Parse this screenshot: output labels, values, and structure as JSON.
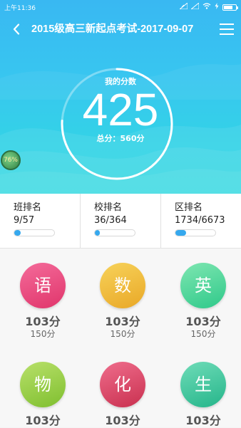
{
  "status": {
    "time": "上午11:36"
  },
  "header": {
    "title": "2015级高三新起点考试-2017-09-07"
  },
  "score": {
    "label": "我的分数",
    "value": "425",
    "total": "总分：560分",
    "percent": 0.759
  },
  "badge": {
    "text": "76%"
  },
  "ranks": [
    {
      "label": "班排名",
      "value": "9/57",
      "fraction": 0.16
    },
    {
      "label": "校排名",
      "value": "36/364",
      "fraction": 0.12
    },
    {
      "label": "区排名",
      "value": "1734/6673",
      "fraction": 0.26
    }
  ],
  "subjects": [
    {
      "name": "语",
      "score": "103分",
      "full": "150分",
      "color_top": "#f46b9a",
      "color_bottom": "#e0356b"
    },
    {
      "name": "数",
      "score": "103分",
      "full": "150分",
      "color_top": "#f7d25a",
      "color_bottom": "#e9a827"
    },
    {
      "name": "英",
      "score": "103分",
      "full": "150分",
      "color_top": "#7ee6b1",
      "color_bottom": "#2fc98a"
    },
    {
      "name": "物",
      "score": "103分",
      "full": "",
      "color_top": "#b8e06a",
      "color_bottom": "#7fbf2f"
    },
    {
      "name": "化",
      "score": "103分",
      "full": "",
      "color_top": "#ef6d8c",
      "color_bottom": "#c9304f"
    },
    {
      "name": "生",
      "score": "103分",
      "full": "",
      "color_top": "#6fdcb8",
      "color_bottom": "#25b58a"
    }
  ],
  "colors": {
    "accent": "#35a8ee",
    "hero_top": "#39b8f2",
    "hero_bottom": "#2fd8e0"
  }
}
